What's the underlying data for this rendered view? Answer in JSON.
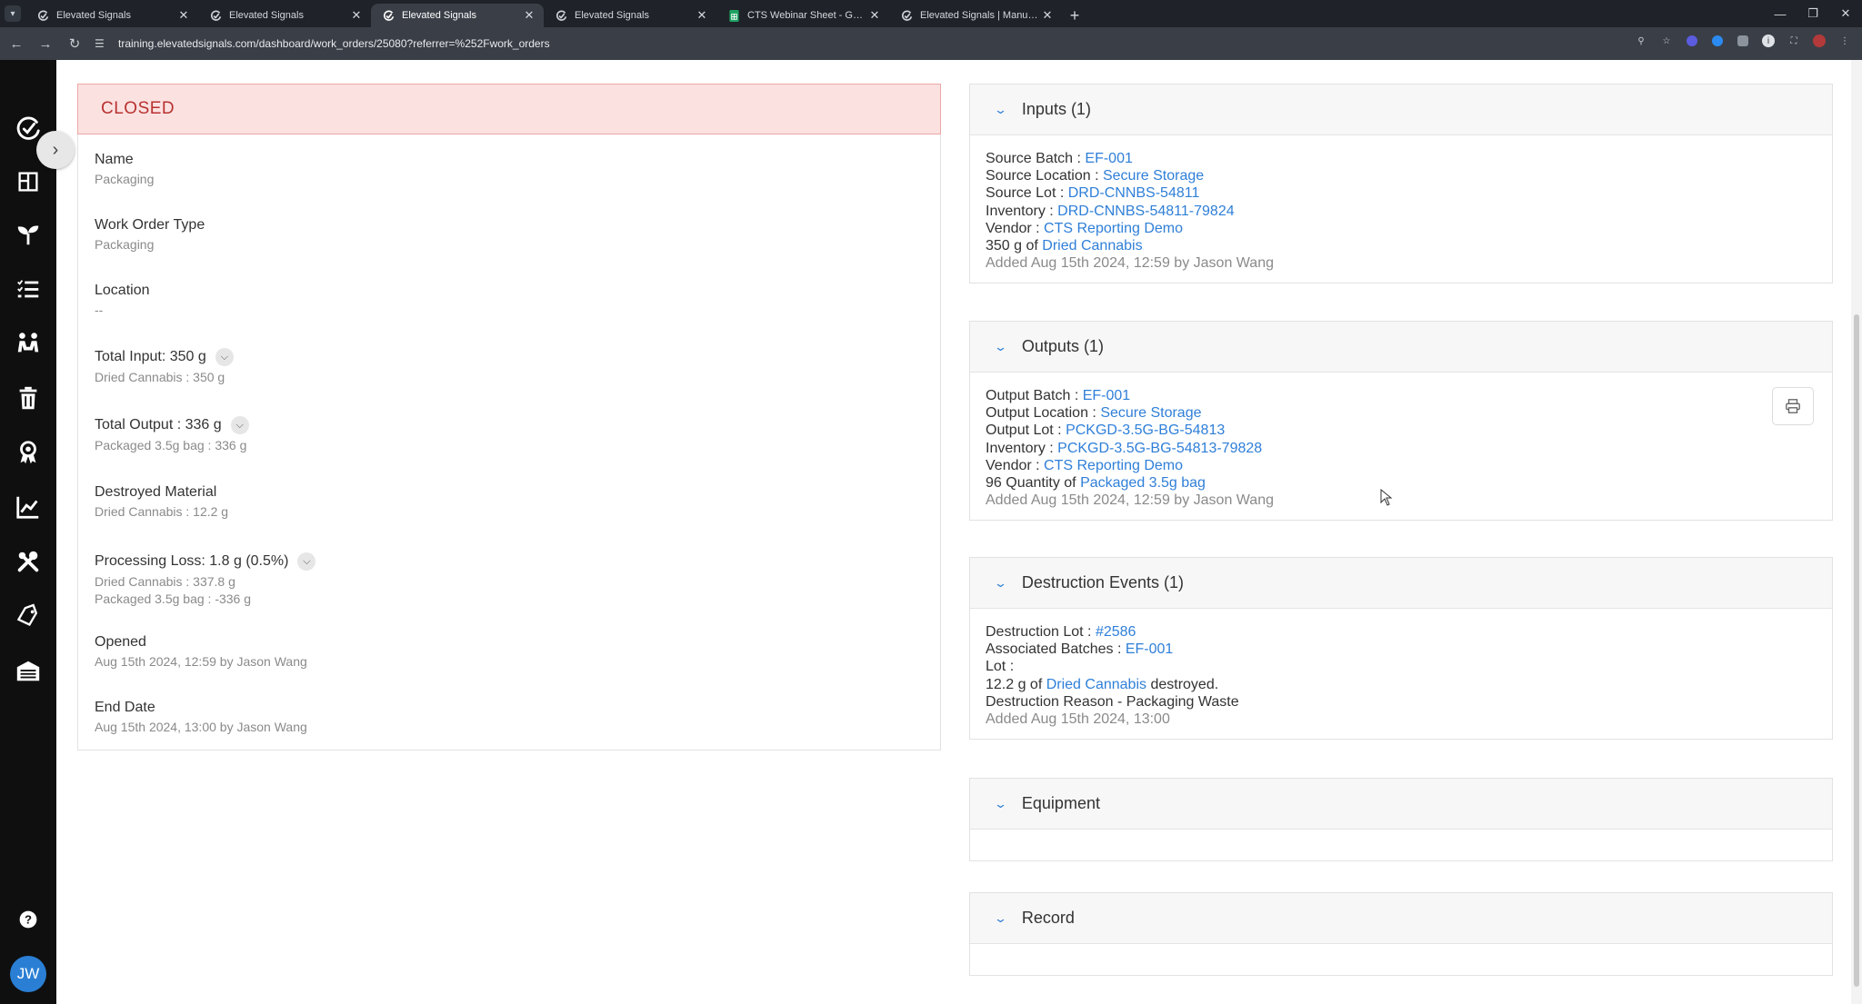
{
  "browser": {
    "tabs": [
      {
        "title": "Elevated Signals",
        "active": false
      },
      {
        "title": "Elevated Signals",
        "active": false
      },
      {
        "title": "Elevated Signals",
        "active": true
      },
      {
        "title": "Elevated Signals",
        "active": false
      },
      {
        "title": "CTS Webinar Sheet - Google Sh",
        "active": false
      },
      {
        "title": "Elevated Signals | Manufacturin",
        "active": false
      }
    ],
    "new_tab": "+",
    "url": "training.elevatedsignals.com/dashboard/work_orders/25080?referrer=%252Fwork_orders"
  },
  "colors": {
    "link": "#2f7fd8",
    "status_bg": "#fbe2e1",
    "status_text": "#b83230",
    "sidebar_bg": "#0f0f10",
    "avatar_bg": "#2a7fd4"
  },
  "sidebar": {
    "icons": [
      "logo-icon",
      "dashboard-icon",
      "plant-icon",
      "list-icon",
      "people-icon",
      "trash-icon",
      "award-icon",
      "chart-icon",
      "tools-icon",
      "tag-icon",
      "warehouse-icon",
      "help-icon"
    ],
    "avatar_initials": "JW"
  },
  "work_order": {
    "status": "CLOSED",
    "fields": [
      {
        "label": "Name",
        "values": [
          "Packaging"
        ]
      },
      {
        "label": "Work Order Type",
        "values": [
          "Packaging"
        ]
      },
      {
        "label": "Location",
        "values": [
          "--"
        ]
      },
      {
        "label": "Total Input: 350 g",
        "values": [
          "Dried Cannabis : 350 g"
        ]
      },
      {
        "label": "Total Output : 336 g",
        "values": [
          "Packaged 3.5g bag : 336 g"
        ]
      },
      {
        "label": "Destroyed Material",
        "values": [
          "Dried Cannabis : 12.2 g"
        ]
      },
      {
        "label": "Processing Loss: 1.8 g (0.5%)",
        "values": [
          "Dried Cannabis : 337.8 g",
          "Packaged 3.5g bag : -336 g"
        ]
      },
      {
        "label": "Opened",
        "values": [
          "Aug 15th 2024, 12:59 by Jason Wang"
        ]
      },
      {
        "label": "End Date",
        "values": [
          "Aug 15th 2024, 13:00 by Jason Wang"
        ]
      }
    ]
  },
  "inputs": {
    "title": "Inputs (1)",
    "source_batch_label": "Source Batch : ",
    "source_batch": "EF-001",
    "source_location_label": "Source Location : ",
    "source_location": "Secure Storage",
    "source_lot_label": "Source Lot : ",
    "source_lot": "DRD-CNNBS-54811",
    "inventory_label": "Inventory : ",
    "inventory": "DRD-CNNBS-54811-79824",
    "vendor_label": "Vendor : ",
    "vendor": "CTS Reporting Demo",
    "qty_prefix": "350 g of ",
    "qty_item": "Dried Cannabis",
    "added": "Added Aug 15th 2024, 12:59 by Jason Wang"
  },
  "outputs": {
    "title": "Outputs (1)",
    "output_batch_label": "Output Batch : ",
    "output_batch": "EF-001",
    "output_location_label": "Output Location : ",
    "output_location": "Secure Storage",
    "output_lot_label": "Output Lot : ",
    "output_lot": "PCKGD-3.5G-BG-54813",
    "inventory_label": "Inventory : ",
    "inventory": "PCKGD-3.5G-BG-54813-79828",
    "vendor_label": "Vendor : ",
    "vendor": "CTS Reporting Demo",
    "qty_prefix": "96 Quantity of ",
    "qty_item": "Packaged 3.5g bag",
    "added": "Added Aug 15th 2024, 12:59 by Jason Wang"
  },
  "destruction": {
    "title": "Destruction Events (1)",
    "lot_label": "Destruction Lot : ",
    "lot": "#2586",
    "batches_label": "Associated Batches : ",
    "batches": "EF-001",
    "lot_line": "Lot :",
    "qty_prefix": "12.2 g of ",
    "qty_item": "Dried Cannabis",
    "qty_suffix": " destroyed.",
    "reason": "Destruction Reason - Packaging Waste",
    "added": "Added Aug 15th 2024, 13:00"
  },
  "equipment": {
    "title": "Equipment"
  },
  "record": {
    "title": "Record"
  }
}
